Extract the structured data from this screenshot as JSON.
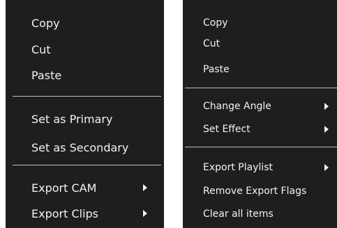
{
  "menus": {
    "left": {
      "copy": "Copy",
      "cut": "Cut",
      "paste": "Paste",
      "set_primary": "Set as Primary",
      "set_secondary": "Set as Secondary",
      "export_cam": "Export CAM",
      "export_clips": "Export Clips"
    },
    "right": {
      "copy": "Copy",
      "cut": "Cut",
      "paste": "Paste",
      "change_angle": "Change Angle",
      "set_effect": "Set Effect",
      "export_playlist": "Export Playlist",
      "remove_export_flags": "Remove Export Flags",
      "clear_all_items": "Clear all items"
    }
  },
  "colors": {
    "menu_background": "#1e1e1e",
    "menu_text": "#f2f2f2",
    "separator": "#bfbfbf",
    "page_background": "#ffffff"
  },
  "icons": {
    "submenu_arrow": "chevron-right-icon"
  }
}
